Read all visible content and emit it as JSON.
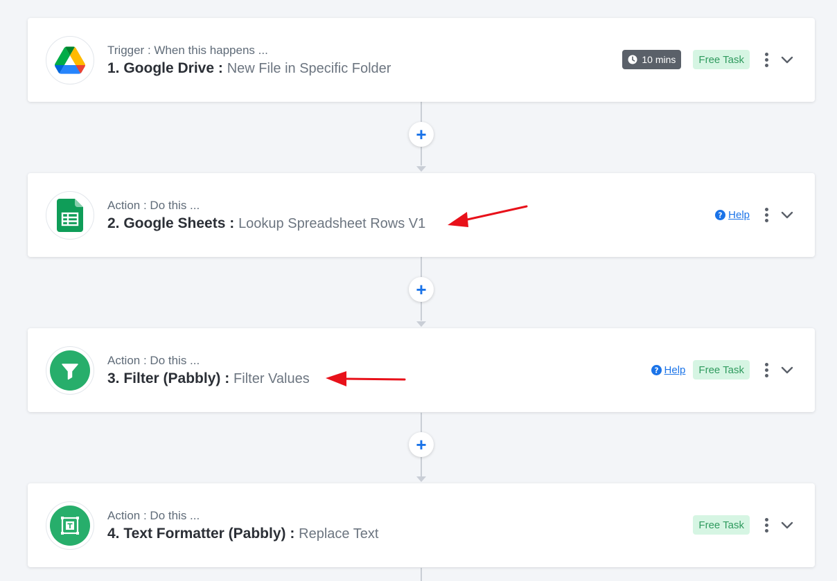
{
  "steps": [
    {
      "type_label": "Trigger : When this happens ...",
      "app_name": "1. Google Drive :",
      "event": "New File in Specific Folder",
      "icon": "google-drive-icon",
      "time_badge": "10 mins",
      "free_task": "Free Task"
    },
    {
      "type_label": "Action : Do this ...",
      "app_name": "2. Google Sheets :",
      "event": "Lookup Spreadsheet Rows V1",
      "icon": "google-sheets-icon",
      "help": "Help"
    },
    {
      "type_label": "Action : Do this ...",
      "app_name": "3. Filter (Pabbly) :",
      "event": "Filter Values",
      "icon": "filter-icon",
      "help": "Help",
      "free_task": "Free Task"
    },
    {
      "type_label": "Action : Do this ...",
      "app_name": "4. Text Formatter (Pabbly) :",
      "event": "Replace Text",
      "icon": "text-formatter-icon",
      "free_task": "Free Task"
    }
  ],
  "add_button_symbol": "+",
  "colors": {
    "accent_blue": "#1a73e8",
    "free_task_bg": "#d6f5e3",
    "free_task_text": "#2f9a5e",
    "annotation_arrow": "#e8111a",
    "pabbly_green": "#27ae6b"
  }
}
